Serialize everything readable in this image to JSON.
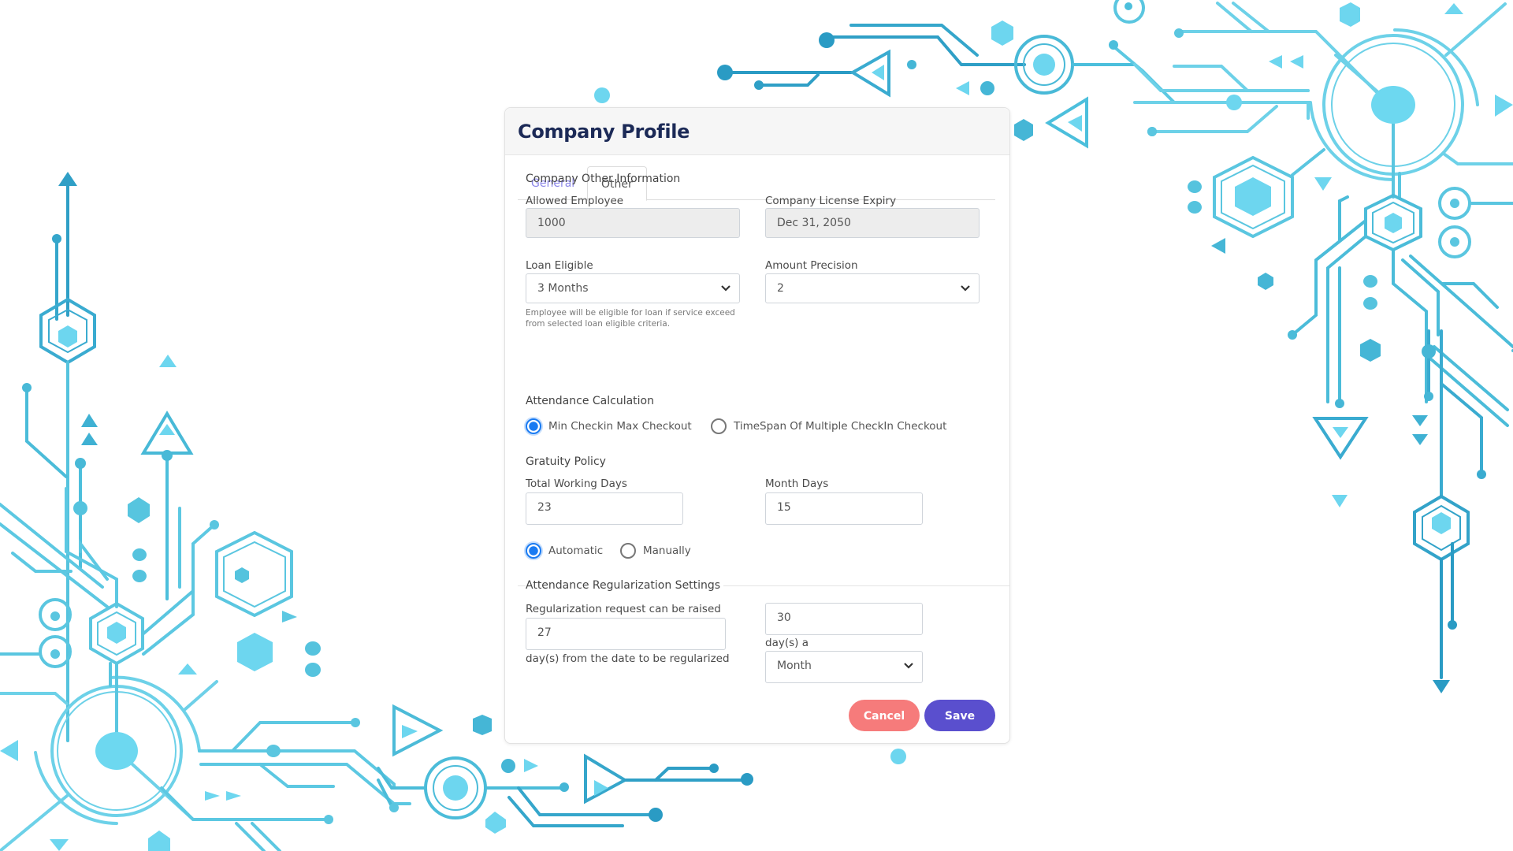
{
  "dialog": {
    "title": "Company Profile",
    "tabs": [
      {
        "label": "General",
        "active": false
      },
      {
        "label": "Other",
        "active": true
      }
    ],
    "section_other_info": "Company Other Information",
    "allowed_employee": {
      "label": "Allowed Employee",
      "value": "1000"
    },
    "license_expiry": {
      "label": "Company License Expiry",
      "value": "Dec 31, 2050"
    },
    "loan_eligible": {
      "label": "Loan Eligible",
      "selected": "3 Months",
      "hint_line1": "Employee will be eligible for loan if service exceed",
      "hint_line2": "from selected loan eligible criteria."
    },
    "amount_precision": {
      "label": "Amount Precision",
      "selected": "2"
    },
    "attendance_calculation": {
      "label": "Attendance Calculation",
      "options": [
        {
          "label": "Min Checkin Max Checkout",
          "checked": true
        },
        {
          "label": "TimeSpan Of Multiple CheckIn Checkout",
          "checked": false
        }
      ]
    },
    "gratuity_policy": {
      "label": "Gratuity Policy",
      "total_working_days": {
        "label": "Total Working Days",
        "value": "23"
      },
      "month_days": {
        "label": "Month Days",
        "value": "15"
      },
      "options": [
        {
          "label": "Automatic",
          "checked": true
        },
        {
          "label": "Manually",
          "checked": false
        }
      ]
    },
    "regularization": {
      "label": "Attendance Regularization Settings",
      "request_label": "Regularization request can be raised",
      "request_value": "27",
      "request_suffix": "day(s) from the date to be regularized",
      "days_value": "30",
      "days_suffix": "day(s) a",
      "period_selected": "Month"
    },
    "buttons": {
      "cancel": "Cancel",
      "save": "Save"
    }
  },
  "colors": {
    "title": "#1c2a57",
    "tab_inactive": "#8b86e8",
    "radio_checked": "#1a7bf2",
    "cancel": "#f67b7b",
    "save": "#5a4fce",
    "decor_dark": "#2a9bc4",
    "decor_light": "#6fd6ef"
  }
}
